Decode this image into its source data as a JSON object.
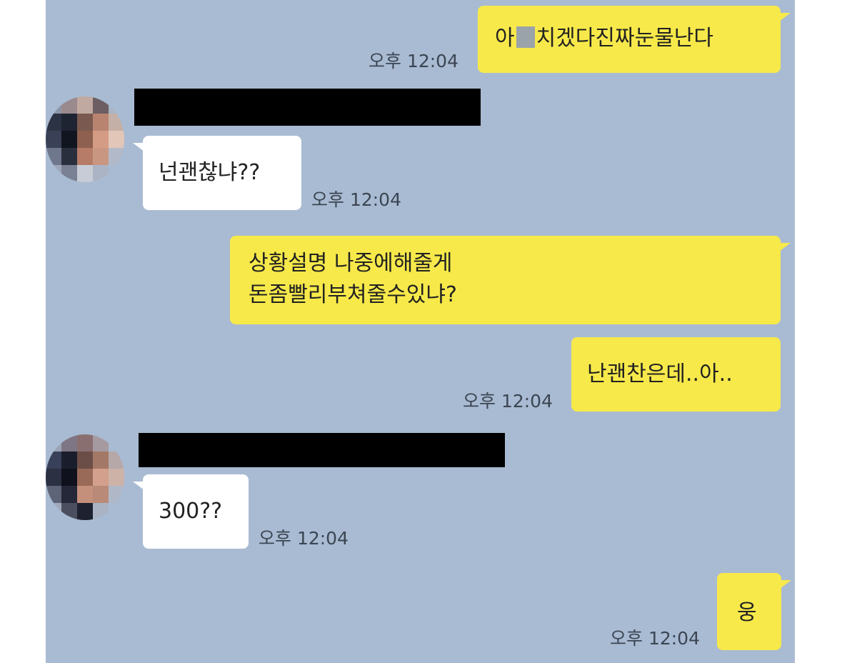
{
  "messages": [
    {
      "side": "me",
      "text_before": "아",
      "text_after": "치겠다진짜눈물난다",
      "time": "오후 12:04"
    },
    {
      "side": "them",
      "text": "넌괜찮냐??",
      "time": "오후 12:04"
    },
    {
      "side": "me",
      "line1": "상황설명 나중에해줄게",
      "line2": "돈좀빨리부쳐줄수있냐?"
    },
    {
      "side": "me",
      "text": "난괜찬은데..아..",
      "time": "오후 12:04"
    },
    {
      "side": "them",
      "text": "300??",
      "time": "오후 12:04"
    },
    {
      "side": "me",
      "text": "웅",
      "time": "오후 12:04"
    }
  ],
  "colors": {
    "background": "#a9bbd2",
    "my_bubble": "#f7e94a",
    "their_bubble": "#ffffff",
    "redaction": "#000000"
  }
}
